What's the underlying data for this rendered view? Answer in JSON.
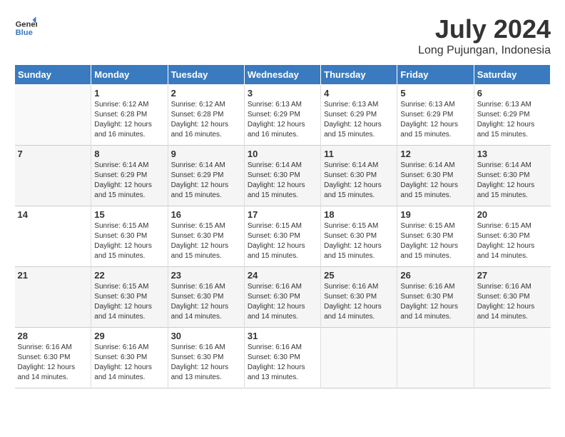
{
  "logo": {
    "line1": "General",
    "line2": "Blue"
  },
  "title": "July 2024",
  "location": "Long Pujungan, Indonesia",
  "days_header": [
    "Sunday",
    "Monday",
    "Tuesday",
    "Wednesday",
    "Thursday",
    "Friday",
    "Saturday"
  ],
  "weeks": [
    [
      {
        "num": "",
        "info": ""
      },
      {
        "num": "1",
        "info": "Sunrise: 6:12 AM\nSunset: 6:28 PM\nDaylight: 12 hours\nand 16 minutes."
      },
      {
        "num": "2",
        "info": "Sunrise: 6:12 AM\nSunset: 6:28 PM\nDaylight: 12 hours\nand 16 minutes."
      },
      {
        "num": "3",
        "info": "Sunrise: 6:13 AM\nSunset: 6:29 PM\nDaylight: 12 hours\nand 16 minutes."
      },
      {
        "num": "4",
        "info": "Sunrise: 6:13 AM\nSunset: 6:29 PM\nDaylight: 12 hours\nand 15 minutes."
      },
      {
        "num": "5",
        "info": "Sunrise: 6:13 AM\nSunset: 6:29 PM\nDaylight: 12 hours\nand 15 minutes."
      },
      {
        "num": "6",
        "info": "Sunrise: 6:13 AM\nSunset: 6:29 PM\nDaylight: 12 hours\nand 15 minutes."
      }
    ],
    [
      {
        "num": "7",
        "info": ""
      },
      {
        "num": "8",
        "info": "Sunrise: 6:14 AM\nSunset: 6:29 PM\nDaylight: 12 hours\nand 15 minutes."
      },
      {
        "num": "9",
        "info": "Sunrise: 6:14 AM\nSunset: 6:29 PM\nDaylight: 12 hours\nand 15 minutes."
      },
      {
        "num": "10",
        "info": "Sunrise: 6:14 AM\nSunset: 6:30 PM\nDaylight: 12 hours\nand 15 minutes."
      },
      {
        "num": "11",
        "info": "Sunrise: 6:14 AM\nSunset: 6:30 PM\nDaylight: 12 hours\nand 15 minutes."
      },
      {
        "num": "12",
        "info": "Sunrise: 6:14 AM\nSunset: 6:30 PM\nDaylight: 12 hours\nand 15 minutes."
      },
      {
        "num": "13",
        "info": "Sunrise: 6:14 AM\nSunset: 6:30 PM\nDaylight: 12 hours\nand 15 minutes."
      }
    ],
    [
      {
        "num": "14",
        "info": ""
      },
      {
        "num": "15",
        "info": "Sunrise: 6:15 AM\nSunset: 6:30 PM\nDaylight: 12 hours\nand 15 minutes."
      },
      {
        "num": "16",
        "info": "Sunrise: 6:15 AM\nSunset: 6:30 PM\nDaylight: 12 hours\nand 15 minutes."
      },
      {
        "num": "17",
        "info": "Sunrise: 6:15 AM\nSunset: 6:30 PM\nDaylight: 12 hours\nand 15 minutes."
      },
      {
        "num": "18",
        "info": "Sunrise: 6:15 AM\nSunset: 6:30 PM\nDaylight: 12 hours\nand 15 minutes."
      },
      {
        "num": "19",
        "info": "Sunrise: 6:15 AM\nSunset: 6:30 PM\nDaylight: 12 hours\nand 15 minutes."
      },
      {
        "num": "20",
        "info": "Sunrise: 6:15 AM\nSunset: 6:30 PM\nDaylight: 12 hours\nand 14 minutes."
      }
    ],
    [
      {
        "num": "21",
        "info": ""
      },
      {
        "num": "22",
        "info": "Sunrise: 6:15 AM\nSunset: 6:30 PM\nDaylight: 12 hours\nand 14 minutes."
      },
      {
        "num": "23",
        "info": "Sunrise: 6:16 AM\nSunset: 6:30 PM\nDaylight: 12 hours\nand 14 minutes."
      },
      {
        "num": "24",
        "info": "Sunrise: 6:16 AM\nSunset: 6:30 PM\nDaylight: 12 hours\nand 14 minutes."
      },
      {
        "num": "25",
        "info": "Sunrise: 6:16 AM\nSunset: 6:30 PM\nDaylight: 12 hours\nand 14 minutes."
      },
      {
        "num": "26",
        "info": "Sunrise: 6:16 AM\nSunset: 6:30 PM\nDaylight: 12 hours\nand 14 minutes."
      },
      {
        "num": "27",
        "info": "Sunrise: 6:16 AM\nSunset: 6:30 PM\nDaylight: 12 hours\nand 14 minutes."
      }
    ],
    [
      {
        "num": "28",
        "info": "Sunrise: 6:16 AM\nSunset: 6:30 PM\nDaylight: 12 hours\nand 14 minutes."
      },
      {
        "num": "29",
        "info": "Sunrise: 6:16 AM\nSunset: 6:30 PM\nDaylight: 12 hours\nand 14 minutes."
      },
      {
        "num": "30",
        "info": "Sunrise: 6:16 AM\nSunset: 6:30 PM\nDaylight: 12 hours\nand 13 minutes."
      },
      {
        "num": "31",
        "info": "Sunrise: 6:16 AM\nSunset: 6:30 PM\nDaylight: 12 hours\nand 13 minutes."
      },
      {
        "num": "",
        "info": ""
      },
      {
        "num": "",
        "info": ""
      },
      {
        "num": "",
        "info": ""
      }
    ]
  ]
}
